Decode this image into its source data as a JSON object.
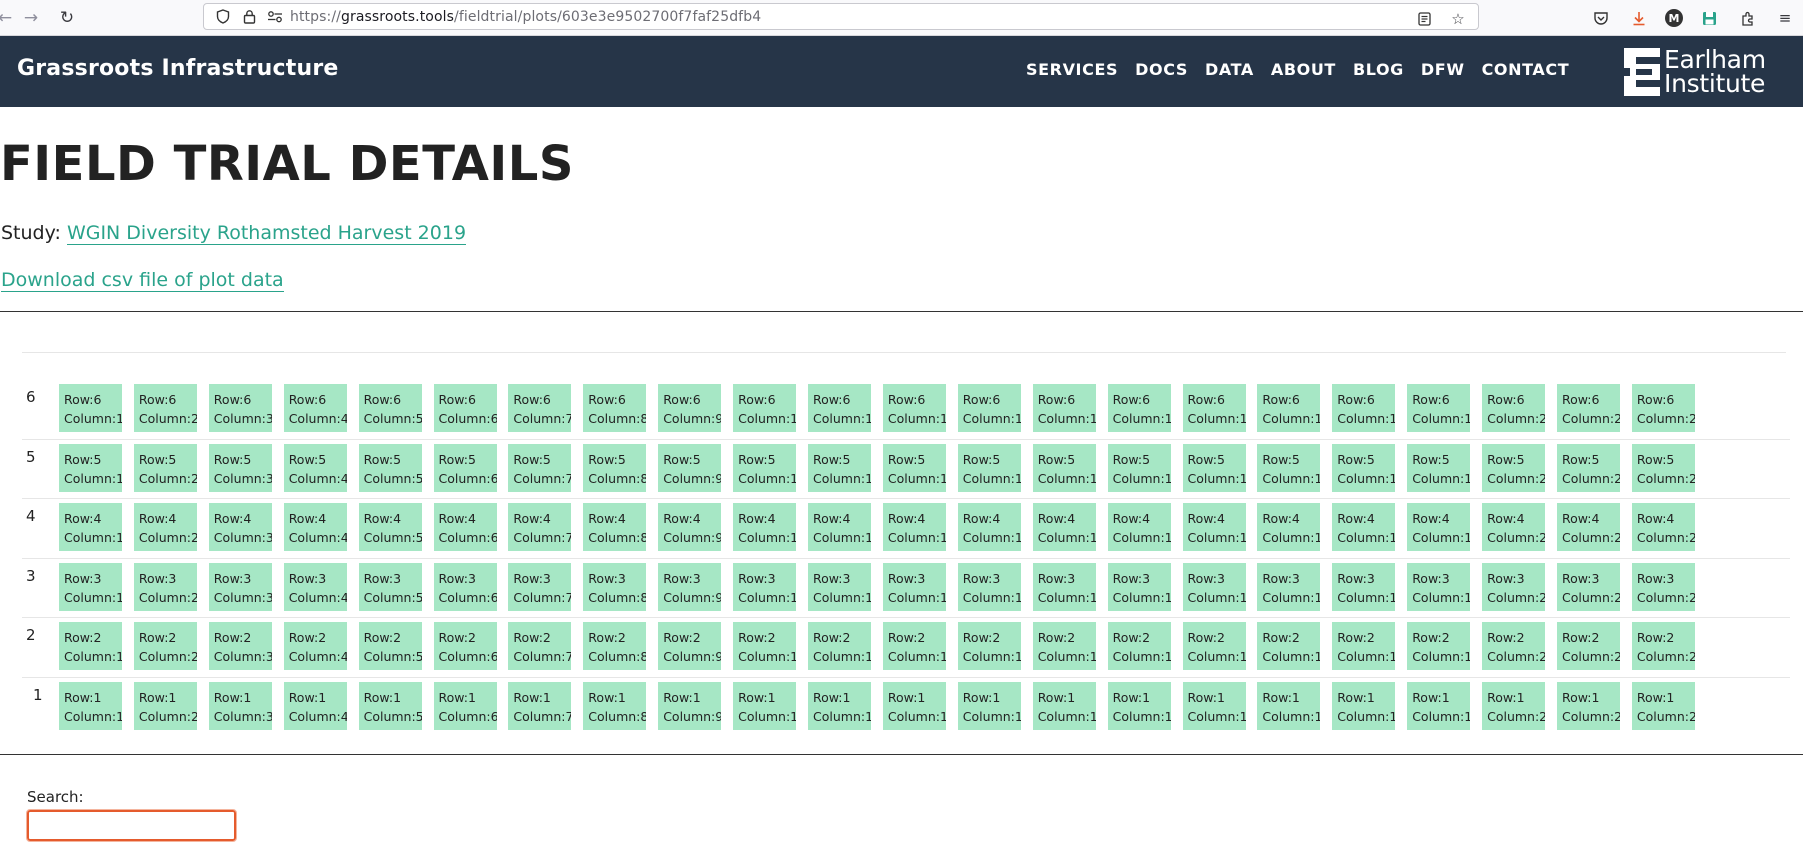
{
  "browser": {
    "url_prefix": "https://",
    "url_host": "grassroots.tools",
    "url_path": "/fieldtrial/plots/603e3e9502700f7faf25dfb4",
    "avatar_letter": "M"
  },
  "site": {
    "title": "Grassroots Infrastructure",
    "nav": [
      "SERVICES",
      "DOCS",
      "DATA",
      "ABOUT",
      "BLOG",
      "DFW",
      "CONTACT"
    ],
    "logo_line1": "Earlham",
    "logo_line2": "Institute",
    "colors": {
      "header_bg": "#263548",
      "link": "#2aa38b",
      "plot_cell": "#a6e7c5"
    }
  },
  "page": {
    "title": "FIELD TRIAL DETAILS",
    "study_label": "Study:",
    "study_link": "WGIN Diversity Rothamsted Harvest 2019",
    "download_link": "Download csv file of plot data"
  },
  "plots": {
    "rows": [
      6,
      5,
      4,
      3,
      2,
      1
    ],
    "columns": 22,
    "row_prefix": "Row:",
    "column_prefix": "Column:"
  },
  "search": {
    "label": "Search:",
    "value": ""
  }
}
